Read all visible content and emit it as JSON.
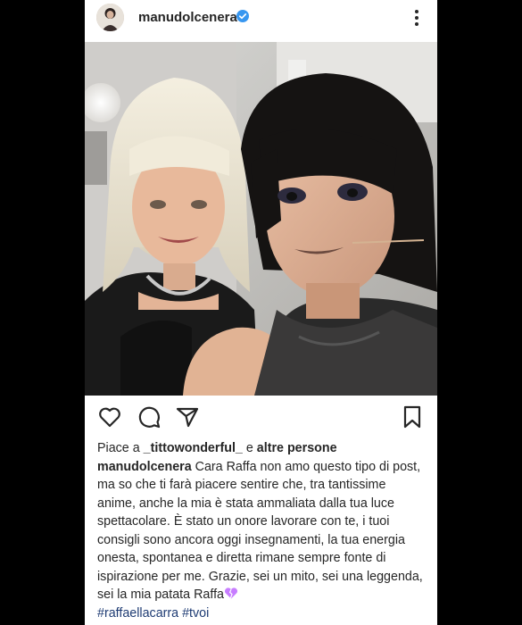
{
  "header": {
    "username": "manudolcenera"
  },
  "likes": {
    "prefix": "Piace a ",
    "user": "_tittowonderful_",
    "middle": " e ",
    "others": "altre persone"
  },
  "caption": {
    "username": "manudolcenera",
    "text": " Cara Raffa non amo questo tipo di post, ma so che ti farà piacere sentire che, tra tantissime anime, anche la mia è stata ammaliata dalla tua luce spettacolare. È stato un onore lavorare con te, i tuoi consigli sono ancora oggi insegnamenti, la tua energia onesta, spontanea e diretta rimane sempre fonte di ispirazione per me. Grazie, sei un mito, sei una leggenda, sei la mia patata Raffa",
    "hashtags": "#raffaellacarra #tvoi"
  },
  "icons": {
    "avatar": "avatar",
    "verified": "verified-badge-icon",
    "more": "more-options-icon",
    "like": "heart-outline-icon",
    "comment": "comment-bubble-icon",
    "share": "paper-plane-icon",
    "save": "bookmark-icon",
    "emoji": "broken-heart-emoji"
  },
  "colors": {
    "verified": "#3897f0",
    "hashtag": "#1e3b73",
    "emoji": "#c77dff"
  }
}
